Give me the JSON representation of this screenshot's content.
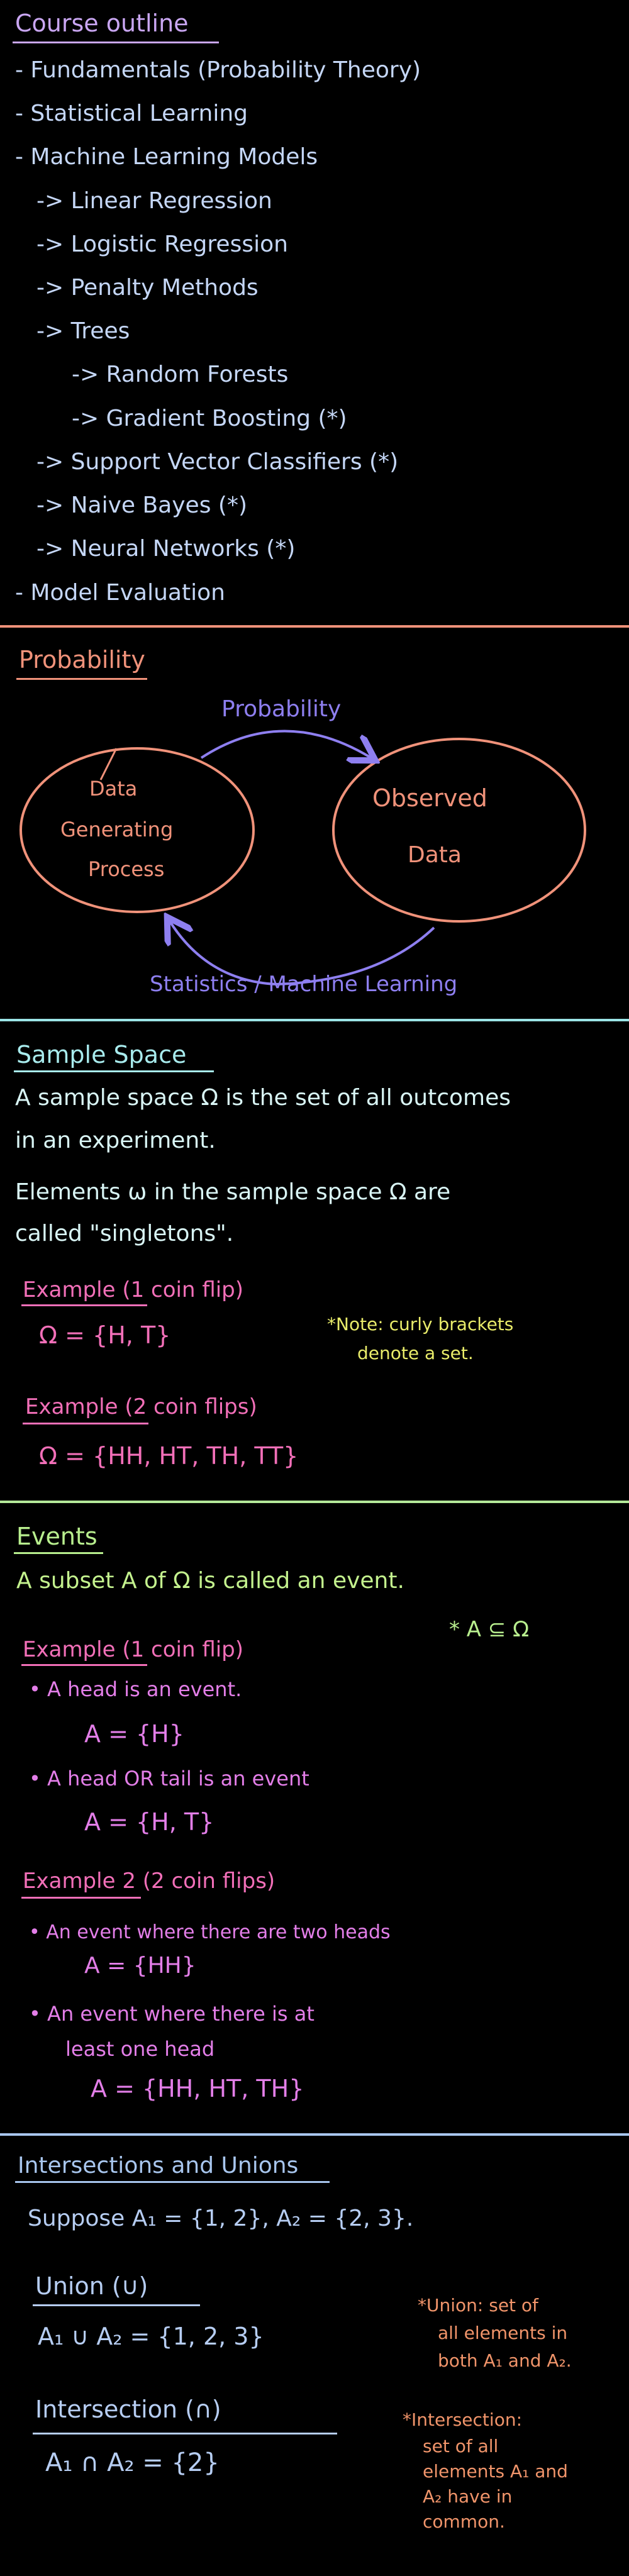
{
  "colors": {
    "background": "#000000",
    "outline_title": "#c9a6f2",
    "outline_text": "#c5d7f7",
    "divider_orange": "#f0927a",
    "divider_teal": "#9be4e6",
    "divider_green": "#b4e899",
    "divider_blue": "#a8c6ee",
    "probability_header": "#f0927a",
    "circle": "#f0927a",
    "arrow": "#8e7ff0",
    "sample_header": "#a8ebed",
    "sample_text": "#d9f5f5",
    "example_pink": "#f26fb8",
    "note_yellow": "#e9ec6a",
    "events_header": "#b8ee8e",
    "events_text": "#c4f28e",
    "events_body": "#e37ee8",
    "intersections_header": "#a8c6ee",
    "intersections_text": "#b6cdf2",
    "orange_note": "#f0946a"
  },
  "outline": {
    "title": "Course outline",
    "items": [
      "- Fundamentals (Probability Theory)",
      "- Statistical Learning",
      "- Machine Learning Models",
      "-> Linear Regression",
      "-> Logistic Regression",
      "-> Penalty Methods",
      "-> Trees",
      "-> Random Forests",
      "-> Gradient Boosting (*)",
      "-> Support Vector Classifiers (*)",
      "-> Naive Bayes (*)",
      "-> Neural Networks (*)",
      "- Model Evaluation"
    ]
  },
  "probability": {
    "title": "Probability",
    "left_circle": [
      "Data",
      "Generating",
      "Process"
    ],
    "right_circle": [
      "Observed",
      "Data"
    ],
    "top_arrow_label": "Probability",
    "bottom_arrow_label": "Statistics / Machine Learning"
  },
  "sample_space": {
    "title": "Sample Space",
    "line1": "A sample space Ω is the set of all outcomes",
    "line2": "in an experiment.",
    "line3": "Elements ω in the sample space Ω are",
    "line4": "called \"singletons\".",
    "example1_label": "Example   (1 coin flip)",
    "example1_eq": "Ω = {H, T}",
    "note": [
      "*Note: curly brackets",
      "denote a set."
    ],
    "example2_label": "Example   (2 coin flips)",
    "example2_eq": "Ω = {HH, HT, TH, TT}"
  },
  "events": {
    "title": "Events",
    "intro": "A subset A of Ω is called an event.",
    "subset_note": "* A ⊆ Ω",
    "example1_label": "Example   (1 coin flip)",
    "b1": "•  A   head   is   an   event.",
    "b1_eq": "A = {H}",
    "b2": "•  A   head   OR   tail   is   an   event",
    "b2_eq": "A = {H, T}",
    "example2_label": "Example  2   (2 coin flips)",
    "b3": "•  An   event   where   there   are   two  heads",
    "b3_eq": "A = {HH}",
    "b4a": "•  An   event   where   there   is   at",
    "b4b": "least   one   head",
    "b4_eq": "A = {HH, HT, TH}"
  },
  "sets": {
    "title": "Intersections and Unions",
    "suppose": "Suppose    A₁ = {1, 2},    A₂ = {2, 3}.",
    "union_label": "Union  (∪)",
    "union_eq": "A₁ ∪ A₂ = {1, 2, 3}",
    "union_note": [
      "*Union: set of",
      "all elements in",
      "both A₁ and A₂."
    ],
    "inter_label": "Intersection  (∩)",
    "inter_eq": "A₁ ∩ A₂ = {2}",
    "inter_note": [
      "*Intersection:",
      "set of all",
      "elements A₁ and",
      "A₂ have in",
      "common."
    ]
  }
}
